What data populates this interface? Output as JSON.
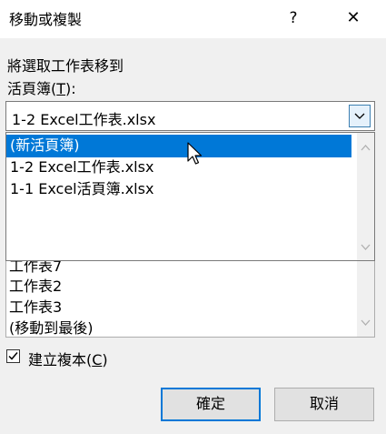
{
  "window": {
    "title": "移動或複製",
    "help_glyph": "?",
    "close_glyph": "✕"
  },
  "move_label": "將選取工作表移到",
  "workbook_label_pre": "活頁簿(",
  "workbook_label_key": "T",
  "workbook_label_post": "):",
  "workbook_select": {
    "value": "1-2 Excel工作表.xlsx",
    "options": [
      "(新活頁簿)",
      "1-2 Excel工作表.xlsx",
      "1-1 Excel活頁簿.xlsx"
    ],
    "highlighted_index": 0
  },
  "before_sheet_items": [
    "工作表7",
    "工作表2",
    "工作表3",
    "(移動到最後)"
  ],
  "copy_checkbox": {
    "label_pre": "建立複本(",
    "label_key": "C",
    "label_post": ")",
    "checked": true
  },
  "buttons": {
    "ok": "確定",
    "cancel": "取消"
  },
  "colors": {
    "highlight": "#0078d7",
    "dialog_bg": "#f0f0f0"
  }
}
